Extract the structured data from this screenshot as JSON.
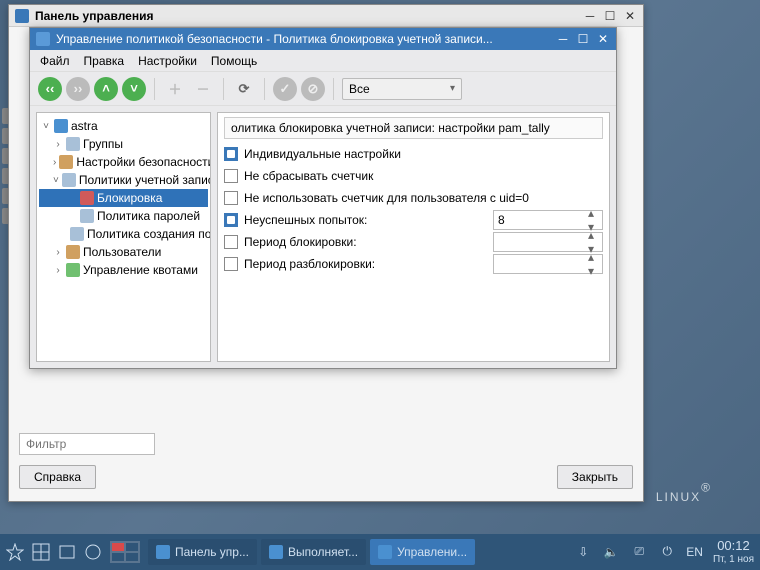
{
  "outer_window": {
    "title": "Панель управления"
  },
  "inner_window": {
    "title": "Управление политикой безопасности - Политика блокировка учетной записи..."
  },
  "menubar": [
    "Файл",
    "Правка",
    "Настройки",
    "Помощь"
  ],
  "toolbar": {
    "combo_value": "Все"
  },
  "tree": {
    "root": "astra",
    "items": [
      {
        "label": "Группы",
        "icon": "groups-icon"
      },
      {
        "label": "Настройки безопасности",
        "icon": "security-icon"
      },
      {
        "label": "Политики учетной записи",
        "icon": "policies-icon",
        "expanded": true,
        "children": [
          {
            "label": "Блокировка",
            "icon": "lock-icon",
            "selected": true
          },
          {
            "label": "Политика паролей",
            "icon": "password-policy-icon"
          },
          {
            "label": "Политика создания пол...",
            "icon": "creation-policy-icon"
          }
        ]
      },
      {
        "label": "Пользователи",
        "icon": "users-icon"
      },
      {
        "label": "Управление квотами",
        "icon": "quota-icon"
      }
    ]
  },
  "detail": {
    "header": "олитика блокировка учетной записи: настройки pam_tally",
    "rows": [
      {
        "key": "individual",
        "label": "Индивидуальные настройки",
        "checked": true,
        "has_spin": false
      },
      {
        "key": "no_reset",
        "label": "Не сбрасывать счетчик",
        "checked": false,
        "has_spin": false
      },
      {
        "key": "uid0",
        "label": "Не использовать счетчик для пользователя с uid=0",
        "checked": false,
        "has_spin": false
      },
      {
        "key": "fail_attempts",
        "label": "Неуспешных попыток:",
        "checked": true,
        "has_spin": true,
        "value": "8"
      },
      {
        "key": "lock_period",
        "label": "Период блокировки:",
        "checked": false,
        "has_spin": true,
        "value": ""
      },
      {
        "key": "unlock_period",
        "label": "Период разблокировки:",
        "checked": false,
        "has_spin": true,
        "value": ""
      }
    ]
  },
  "filter": {
    "placeholder": "Фильтр"
  },
  "buttons": {
    "help": "Справка",
    "close": "Закрыть"
  },
  "brand": "LINUX",
  "taskbar": {
    "tasks": [
      {
        "label": "Панель упр...",
        "active": false
      },
      {
        "label": "Выполняет...",
        "active": false
      },
      {
        "label": "Управлени...",
        "active": true
      }
    ],
    "lang": "EN",
    "time": "00:12",
    "date": "Пт, 1 ноя"
  }
}
